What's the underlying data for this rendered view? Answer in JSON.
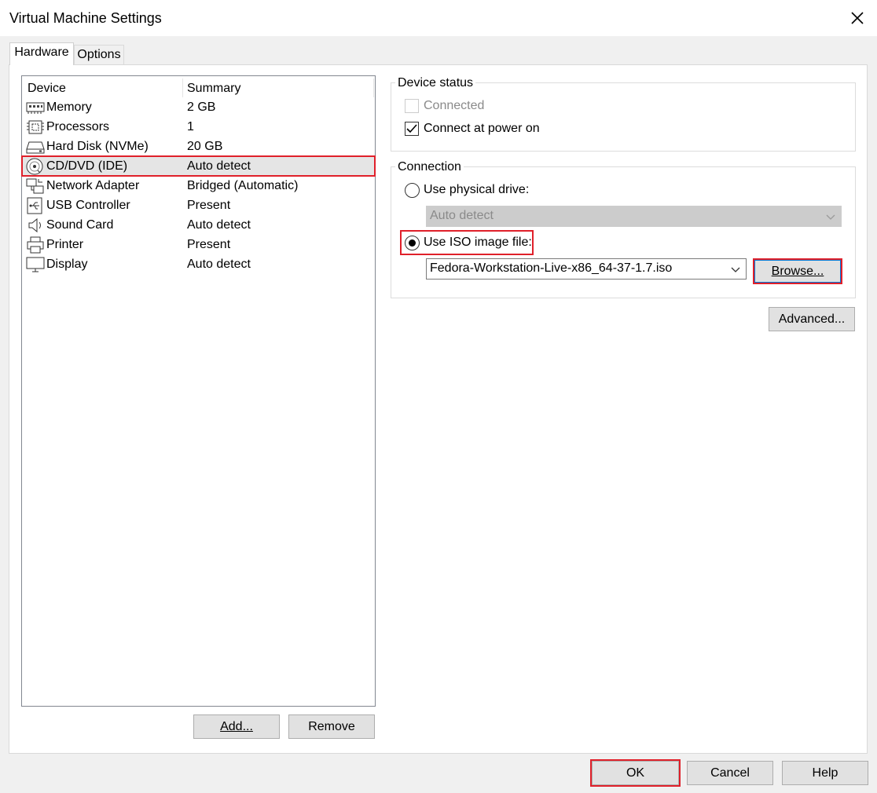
{
  "window": {
    "title": "Virtual Machine Settings"
  },
  "tabs": [
    {
      "label": "Hardware",
      "active": true
    },
    {
      "label": "Options",
      "active": false
    }
  ],
  "device_list": {
    "headers": {
      "device": "Device",
      "summary": "Summary"
    },
    "rows": [
      {
        "icon": "memory-icon",
        "name": "Memory",
        "summary": "2 GB"
      },
      {
        "icon": "processor-icon",
        "name": "Processors",
        "summary": "1"
      },
      {
        "icon": "hard-disk-icon",
        "name": "Hard Disk (NVMe)",
        "summary": "20 GB"
      },
      {
        "icon": "cd-dvd-icon",
        "name": "CD/DVD (IDE)",
        "summary": "Auto detect",
        "selected": true
      },
      {
        "icon": "network-adapter-icon",
        "name": "Network Adapter",
        "summary": "Bridged (Automatic)"
      },
      {
        "icon": "usb-icon",
        "name": "USB Controller",
        "summary": "Present"
      },
      {
        "icon": "speaker-icon",
        "name": "Sound Card",
        "summary": "Auto detect"
      },
      {
        "icon": "printer-icon",
        "name": "Printer",
        "summary": "Present"
      },
      {
        "icon": "display-icon",
        "name": "Display",
        "summary": "Auto detect"
      }
    ]
  },
  "device_buttons": {
    "add": "Add...",
    "remove": "Remove"
  },
  "device_status": {
    "group_label": "Device status",
    "connected": {
      "label": "Connected",
      "checked": false,
      "enabled": false
    },
    "connect_at_power_on": {
      "label": "Connect at power on",
      "checked": true
    }
  },
  "connection": {
    "group_label": "Connection",
    "physical_drive": {
      "label": "Use physical drive:",
      "selected": false,
      "value": "Auto detect"
    },
    "iso_image": {
      "label": "Use ISO image file:",
      "selected": true,
      "value": "Fedora-Workstation-Live-x86_64-37-1.7.iso"
    },
    "browse": "Browse..."
  },
  "advanced_button": "Advanced...",
  "footer": {
    "ok": "OK",
    "cancel": "Cancel",
    "help": "Help"
  },
  "colors": {
    "highlight": "#e0202a",
    "button_face": "#e1e1e1",
    "window_bg": "#f0f0f0"
  }
}
